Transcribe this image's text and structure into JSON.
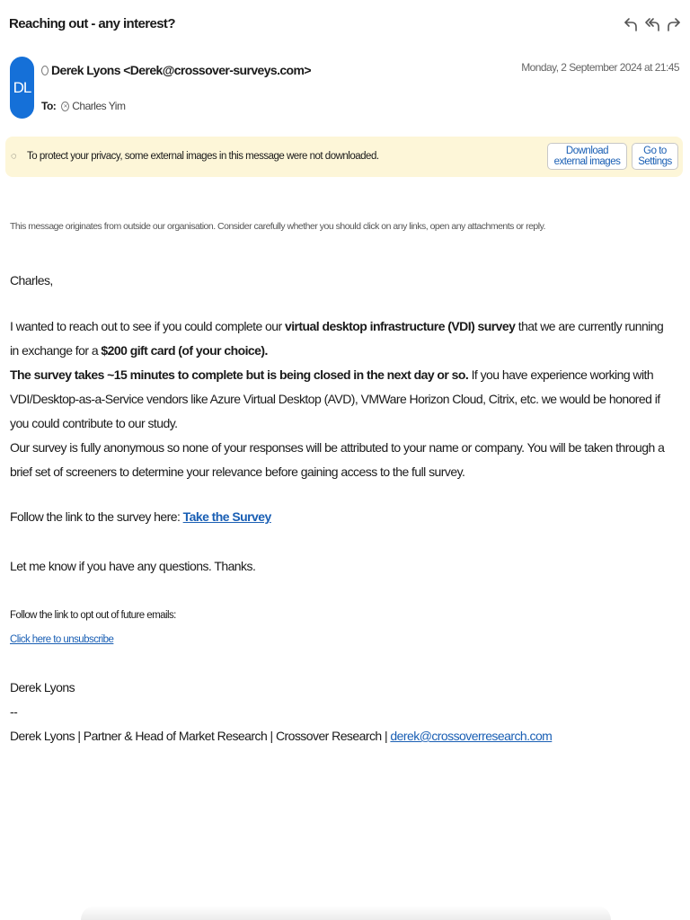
{
  "header": {
    "subject": "Reaching out - any interest?",
    "actions": [
      {
        "icon": "reply-icon"
      },
      {
        "icon": "reply-all-icon"
      },
      {
        "icon": "forward-icon"
      }
    ],
    "sender_initials": "DL",
    "sender": "Derek Lyons <Derek@crossover-surveys.com>",
    "to_label": "To:",
    "recipient": "Charles Yim",
    "date": "Monday, 2 September 2024 at 21:45"
  },
  "banner": {
    "text": "To protect your privacy, some external images in this message were not downloaded.",
    "download_label": "Download external images",
    "settings_label": "Go to Settings"
  },
  "body": {
    "disclaimer": "This message originates from outside our organisation. Consider carefully whether you should click on any links, open any attachments or reply.",
    "greeting": "Charles,",
    "p1": {
      "a": "I wanted to reach out to see if you could complete our ",
      "b": "virtual desktop infrastructure (VDI) survey",
      "c": " that we are currently running in exchange for a ",
      "d": "$200 gift card (of your choice)."
    },
    "p2": {
      "bold": "The survey takes ~15 minutes to complete but is being closed in the next day or so.",
      "rest": " If you have experience working with VDI/Desktop-as-a-Service vendors like Azure Virtual Desktop (AVD), VMWare Horizon Cloud, Citrix, etc. we would be honored if you could contribute to our study."
    },
    "p3": "Our survey is fully anonymous so none of your responses will be attributed to your name or company. You will be taken through a brief set of screeners to determine your relevance before gaining access to the full survey.",
    "p4": {
      "text": "Follow the link to the survey here: ",
      "link": "Take the Survey"
    },
    "p5": "Let me know if you have any questions. Thanks.",
    "optout_text": "Follow the link to opt out of future emails:",
    "unsubscribe_link": "Click here to unsubscribe",
    "sign_name": "Derek Lyons",
    "sign_sep": "--",
    "sign_line": "Derek Lyons | Partner & Head of Market Research | Crossover Research | ",
    "sign_email": "derek@crossoverresearch.com"
  }
}
